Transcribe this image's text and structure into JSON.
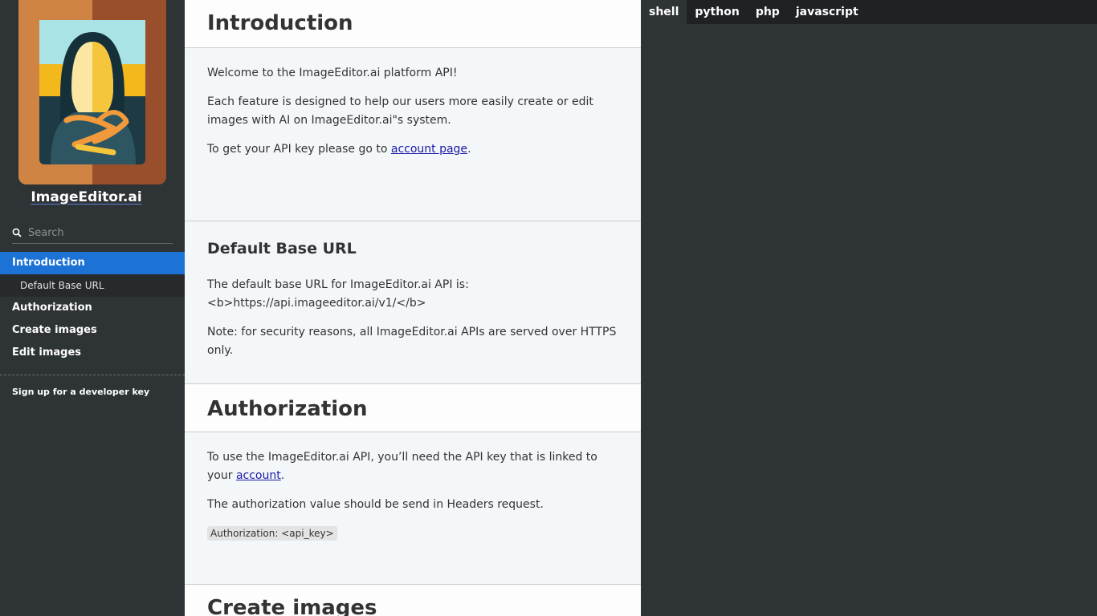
{
  "sidebar": {
    "brand": "ImageEditor.ai",
    "search_placeholder": "Search",
    "nav": [
      {
        "label": "Introduction",
        "active": true
      },
      {
        "label": "Default Base URL",
        "sub": true
      },
      {
        "label": "Authorization"
      },
      {
        "label": "Create images"
      },
      {
        "label": "Edit images"
      }
    ],
    "signup": "Sign up for a developer key"
  },
  "content": {
    "intro": {
      "title": "Introduction",
      "p1": "Welcome to the ImageEditor.ai platform API!",
      "p2": "Each feature is designed to help our users more easily create or edit images with AI on ImageEditor.ai\"s system.",
      "p3_prefix": "To get your API key please go to ",
      "p3_link": "account page",
      "p3_suffix": "."
    },
    "base_url": {
      "title": "Default Base URL",
      "p1": "The default base URL for ImageEditor.ai API is: <b>https://api.imageeditor.ai/v1/</b>",
      "p2": "Note: for security reasons, all ImageEditor.ai APIs are served over HTTPS only."
    },
    "auth": {
      "title": "Authorization",
      "p1_prefix": "To use the ImageEditor.ai API, you’ll need the API key that is linked to your ",
      "p1_link": "account",
      "p1_suffix": ".",
      "p2": "The authorization value should be send in Headers request.",
      "code": "Authorization: <api_key>"
    },
    "create": {
      "title": "Create images"
    }
  },
  "code_tabs": [
    {
      "label": "shell",
      "active": true
    },
    {
      "label": "python"
    },
    {
      "label": "php"
    },
    {
      "label": "javascript"
    }
  ],
  "colors": {
    "sidebar_bg": "#2e3336",
    "active_nav": "#1d72d6",
    "content_bg": "#f3f7f9",
    "link": "#1a1aa6"
  }
}
